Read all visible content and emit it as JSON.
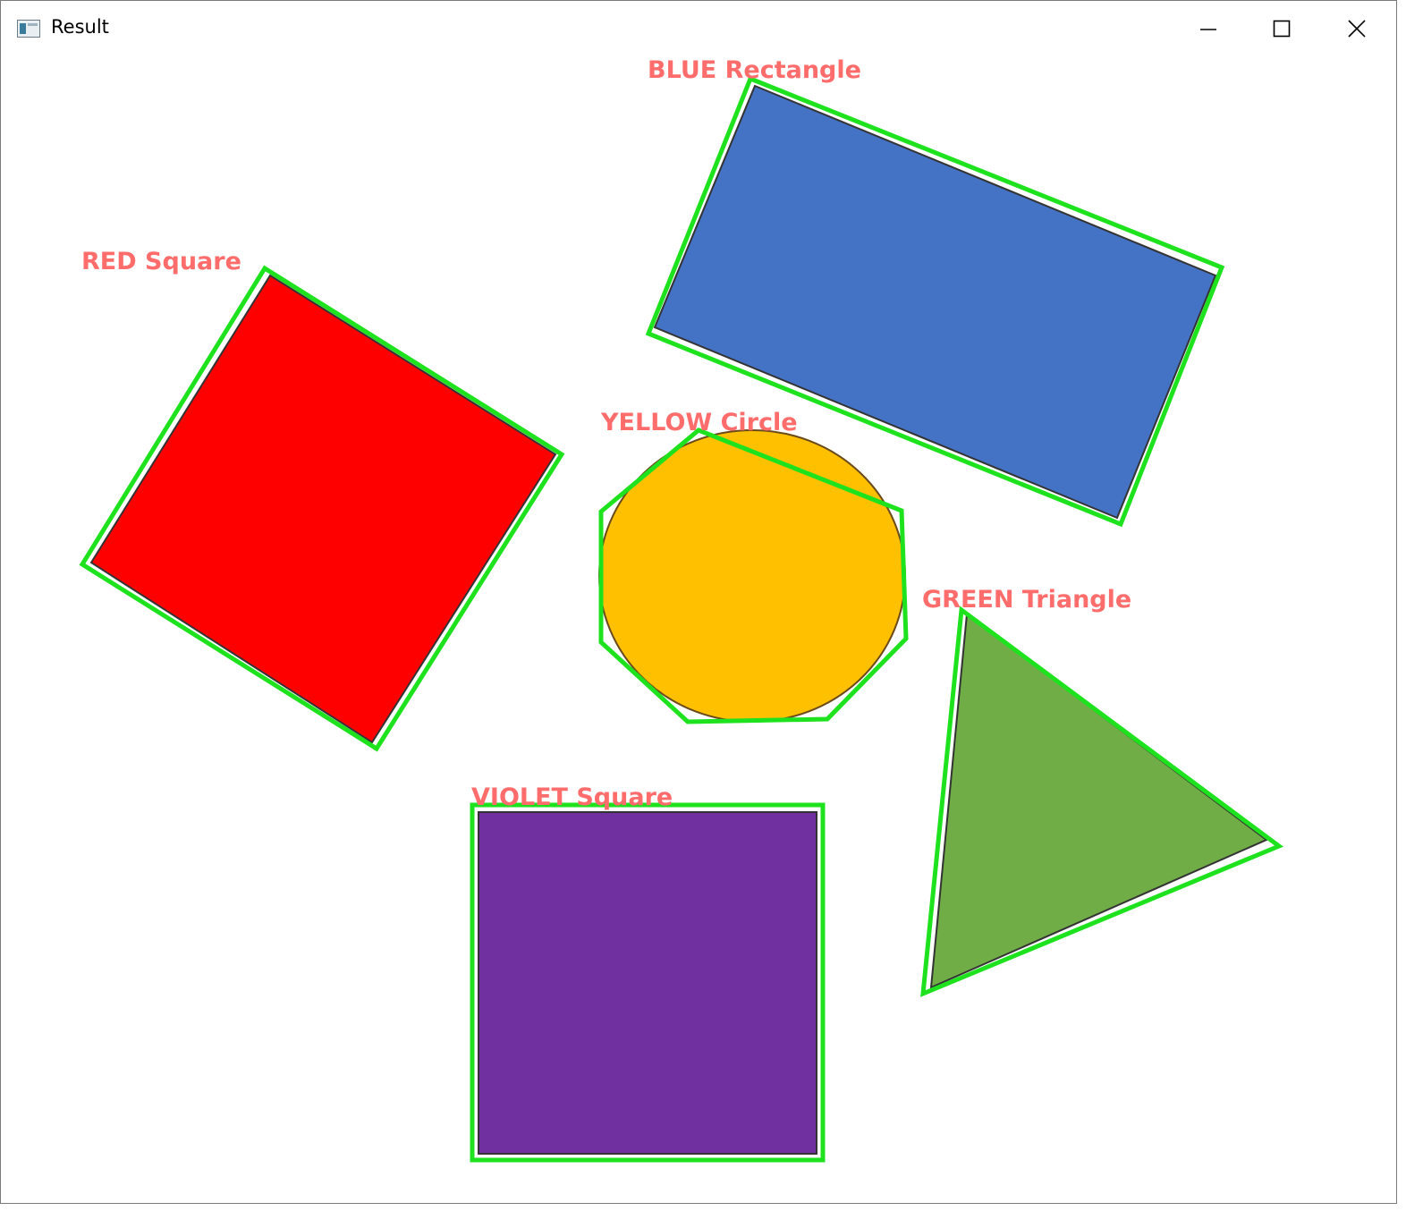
{
  "window": {
    "title": "Result",
    "controls": [
      "minimize-icon",
      "maximize-icon",
      "close-icon"
    ]
  },
  "colors": {
    "contour": "#1fe21f",
    "label": "#ff6c6c",
    "red": "#ff0000",
    "blue": "#4472c4",
    "yellow": "#ffc000",
    "green": "#70ad47",
    "violet": "#7030a0"
  },
  "shapes": [
    {
      "id": "red",
      "label": "RED Square"
    },
    {
      "id": "blue",
      "label": "BLUE Rectangle"
    },
    {
      "id": "yellow",
      "label": "YELLOW Circle"
    },
    {
      "id": "green",
      "label": "GREEN Triangle"
    },
    {
      "id": "violet",
      "label": "VIOLET Square"
    }
  ]
}
